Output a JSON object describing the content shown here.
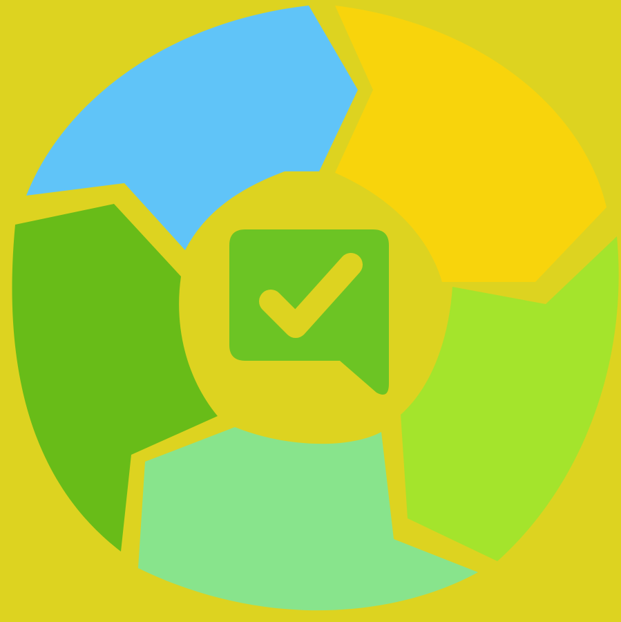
{
  "logo": {
    "name": "cycle-checkmark-logo",
    "background_color": "#DDD320",
    "segments": [
      {
        "name": "segment-blue",
        "color": "#60C4F8"
      },
      {
        "name": "segment-yellow",
        "color": "#F8D40C"
      },
      {
        "name": "segment-lime",
        "color": "#A4E42C"
      },
      {
        "name": "segment-mint",
        "color": "#88E48C"
      },
      {
        "name": "segment-green",
        "color": "#68BC18"
      }
    ],
    "center": {
      "icon": "chat-bubble-check-icon",
      "bubble_color": "#6CC424",
      "check_color": "#DDD320"
    }
  }
}
